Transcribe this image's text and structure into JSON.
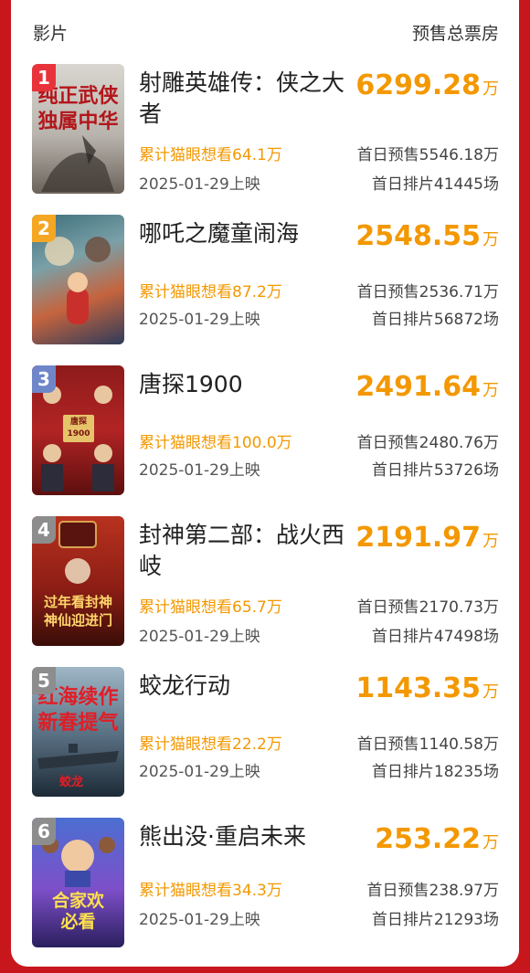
{
  "header": {
    "left": "影片",
    "right": "预售总票房"
  },
  "unit": "万",
  "movies": [
    {
      "rank": "1",
      "title": "射雕英雄传：侠之大者",
      "gross": "6299.28",
      "want": "累计猫眼想看64.1万",
      "date": "2025-01-29上映",
      "presale": "首日预售5546.18万",
      "shows": "首日排片41445场",
      "poster_text": "纯正武侠独属中华",
      "rank_color": "#e8333a"
    },
    {
      "rank": "2",
      "title": "哪吒之魔童闹海",
      "gross": "2548.55",
      "want": "累计猫眼想看87.2万",
      "date": "2025-01-29上映",
      "presale": "首日预售2536.71万",
      "shows": "首日排片56872场",
      "poster_text": "",
      "rank_color": "#f5a623"
    },
    {
      "rank": "3",
      "title": "唐探1900",
      "gross": "2491.64",
      "want": "累计猫眼想看100.0万",
      "date": "2025-01-29上映",
      "presale": "首日预售2480.76万",
      "shows": "首日排片53726场",
      "poster_text": "唐探1900",
      "rank_color": "#6f86c8"
    },
    {
      "rank": "4",
      "title": "封神第二部：战火西岐",
      "gross": "2191.97",
      "want": "累计猫眼想看65.7万",
      "date": "2025-01-29上映",
      "presale": "首日预售2170.73万",
      "shows": "首日排片47498场",
      "poster_text": "过年看封神神仙迎进门",
      "rank_color": "#8d8d8d"
    },
    {
      "rank": "5",
      "title": "蛟龙行动",
      "gross": "1143.35",
      "want": "累计猫眼想看22.2万",
      "date": "2025-01-29上映",
      "presale": "首日预售1140.58万",
      "shows": "首日排片18235场",
      "poster_text": "红海续作新春提气",
      "rank_color": "#8d8d8d"
    },
    {
      "rank": "6",
      "title": "熊出没·重启未来",
      "gross": "253.22",
      "want": "累计猫眼想看34.3万",
      "date": "2025-01-29上映",
      "presale": "首日预售238.97万",
      "shows": "首日排片21293场",
      "poster_text": "合家欢必看",
      "rank_color": "#8d8d8d"
    }
  ]
}
